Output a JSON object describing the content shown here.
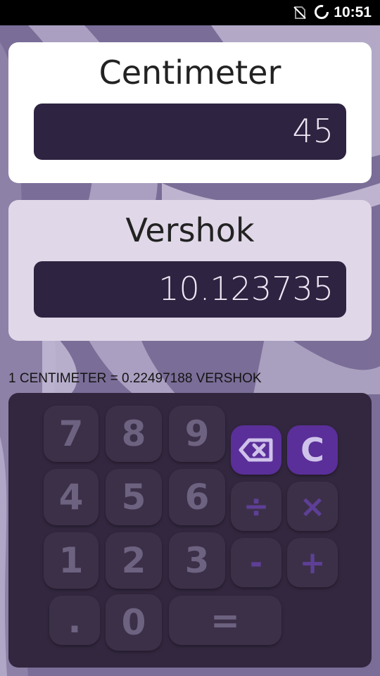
{
  "status_bar": {
    "time": "10:51",
    "icons": [
      "no-sim-icon",
      "loading-icon"
    ]
  },
  "from_unit": {
    "title": "Centimeter",
    "value": "45"
  },
  "to_unit": {
    "title": "Vershok",
    "value": "10.123735"
  },
  "conversion_note": "1 CENTIMETER = 0.22497188 VERSHOK",
  "keypad": {
    "seven": "7",
    "eight": "8",
    "nine": "9",
    "four": "4",
    "five": "5",
    "six": "6",
    "one": "1",
    "two": "2",
    "three": "3",
    "dot": ".",
    "zero": "0",
    "equals": "=",
    "clear": "C",
    "divide": "÷",
    "multiply": "×",
    "minus": "-",
    "plus": "+",
    "backspace_icon": "backspace-icon"
  },
  "colors": {
    "keypad_bg": "#33273f",
    "key_bg": "#3c3049",
    "accent": "#5a2f99",
    "field_bg": "#2e2341"
  }
}
